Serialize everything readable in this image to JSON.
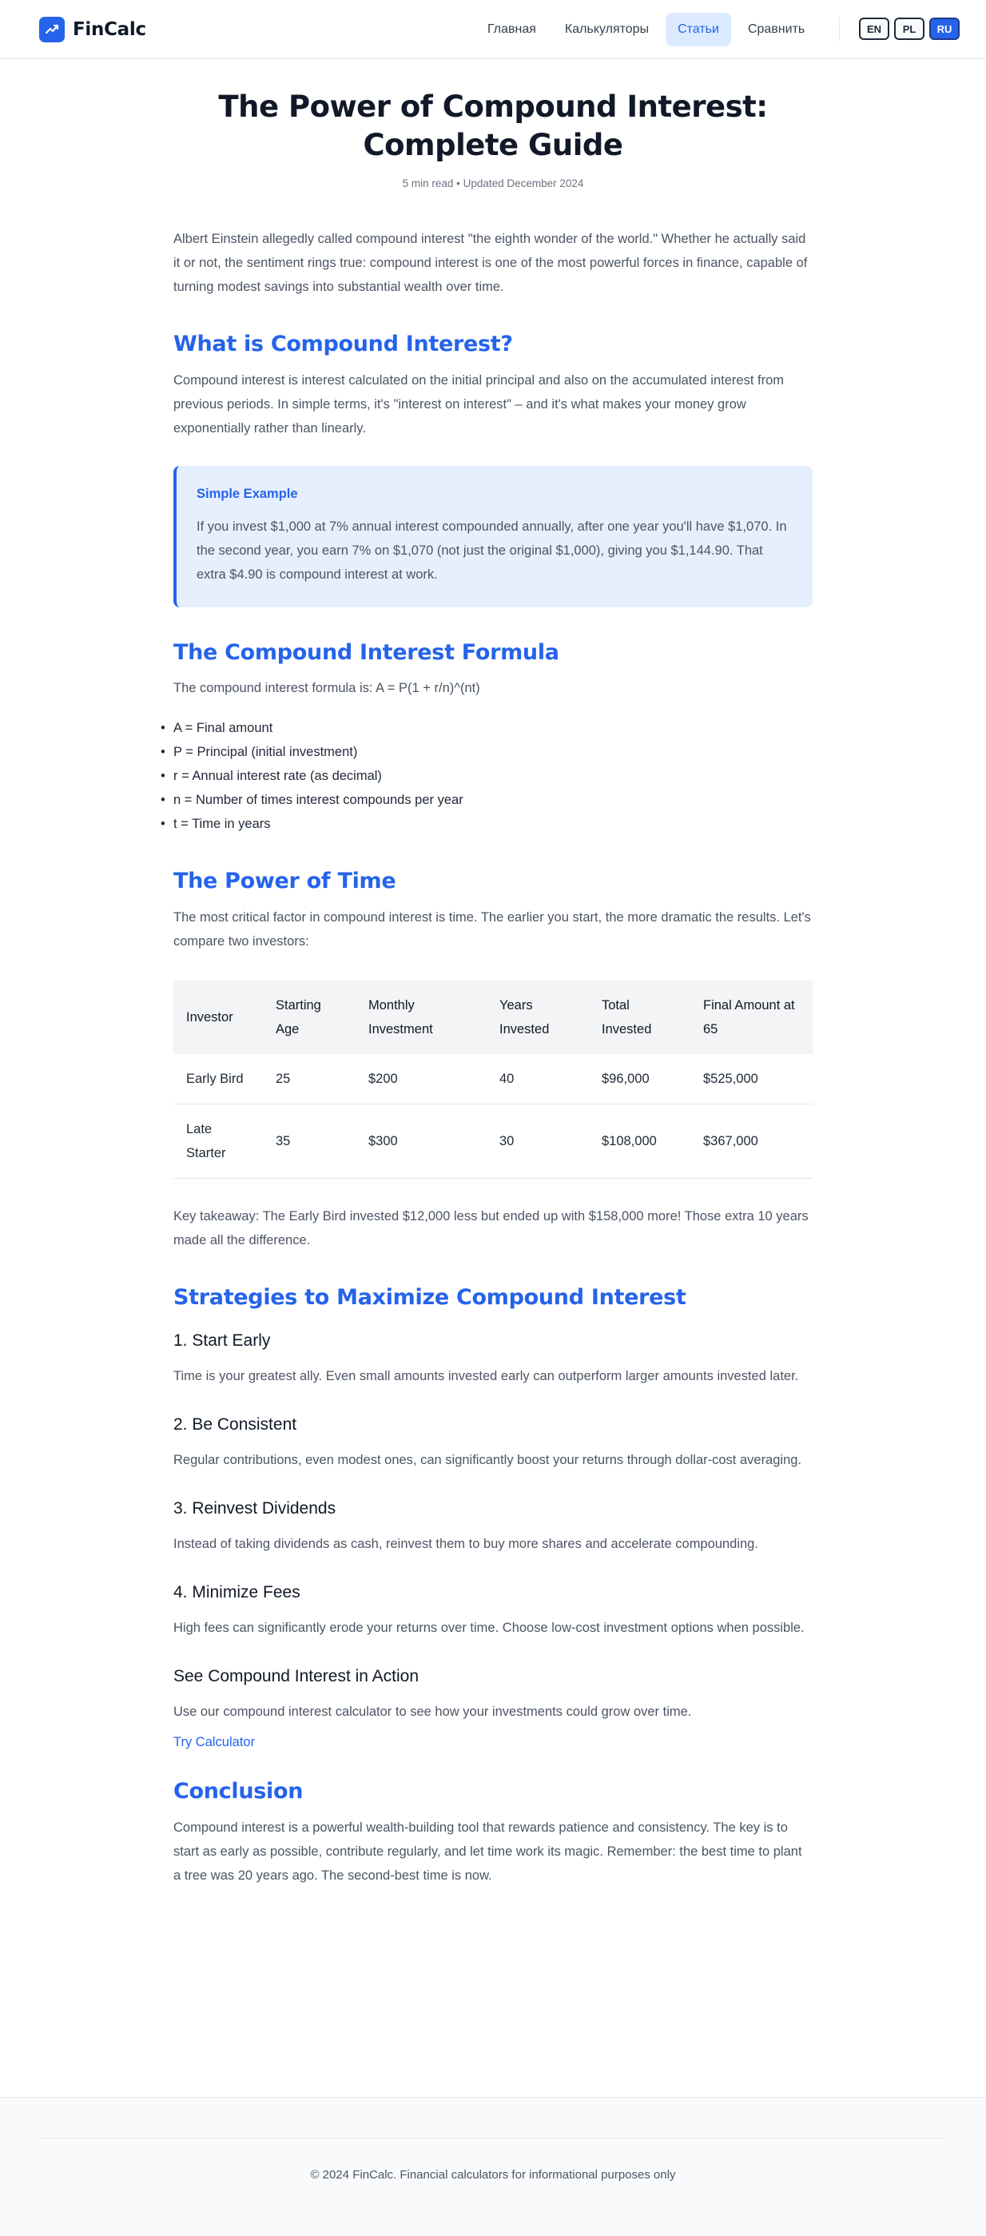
{
  "header": {
    "brand": "FinCalc",
    "nav": [
      "Главная",
      "Калькуляторы",
      "Статьи",
      "Сравнить"
    ],
    "active_nav": "Статьи",
    "languages": [
      "EN",
      "PL",
      "RU"
    ],
    "active_language": "RU"
  },
  "article": {
    "title_line1": "The Power of Compound Interest:",
    "title_line2": "Complete Guide",
    "meta": "5 min read • Updated December 2024",
    "intro": "Albert Einstein allegedly called compound interest \"the eighth wonder of the world.\" Whether he actually said it or not, the sentiment rings true: compound interest is one of the most powerful forces in finance, capable of turning modest savings into substantial wealth over time.",
    "what_heading": "What is Compound Interest?",
    "what_text": "Compound interest is interest calculated on the initial principal and also on the accumulated interest from previous periods. In simple terms, it's \"interest on interest\" – and it's what makes your money grow exponentially rather than linearly.",
    "example_title": "Simple Example",
    "example_text": "If you invest $1,000 at 7% annual interest compounded annually, after one year you'll have $1,070. In the second year, you earn 7% on $1,070 (not just the original $1,000), giving you $1,144.90. That extra $4.90 is compound interest at work.",
    "formula_heading": "The Compound Interest Formula",
    "formula_text": "The compound interest formula is: A = P(1 + r/n)^(nt)",
    "formula_vars": [
      "A = Final amount",
      "P = Principal (initial investment)",
      "r = Annual interest rate (as decimal)",
      "n = Number of times interest compounds per year",
      "t = Time in years"
    ],
    "time_heading": "The Power of Time",
    "time_text": "The most critical factor in compound interest is time. The earlier you start, the more dramatic the results. Let's compare two investors:",
    "table": {
      "headers": [
        "Investor",
        "Starting Age",
        "Monthly Investment",
        "Years Invested",
        "Total Invested",
        "Final Amount at 65"
      ],
      "rows": [
        [
          "Early Bird",
          "25",
          "$200",
          "40",
          "$96,000",
          "$525,000"
        ],
        [
          "Late Starter",
          "35",
          "$300",
          "30",
          "$108,000",
          "$367,000"
        ]
      ]
    },
    "takeaway": "Key takeaway: The Early Bird invested $12,000 less but ended up with $158,000 more! Those extra 10 years made all the difference.",
    "strategies_heading": "Strategies to Maximize Compound Interest",
    "strategies": [
      {
        "title": "1. Start Early",
        "text": "Time is your greatest ally. Even small amounts invested early can outperform larger amounts invested later."
      },
      {
        "title": "2. Be Consistent",
        "text": "Regular contributions, even modest ones, can significantly boost your returns through dollar-cost averaging."
      },
      {
        "title": "3. Reinvest Dividends",
        "text": "Instead of taking dividends as cash, reinvest them to buy more shares and accelerate compounding."
      },
      {
        "title": "4. Minimize Fees",
        "text": "High fees can significantly erode your returns over time. Choose low-cost investment options when possible."
      }
    ],
    "action_heading": "See Compound Interest in Action",
    "action_text": "Use our compound interest calculator to see how your investments could grow over time.",
    "action_link": "Try Calculator",
    "conclusion_heading": "Conclusion",
    "conclusion_text": "Compound interest is a powerful wealth-building tool that rewards patience and consistency. The key is to start as early as possible, contribute regularly, and let time work its magic. Remember: the best time to plant a tree was 20 years ago. The second-best time is now."
  },
  "footer": {
    "text": "© 2024 FinCalc. Financial calculators for informational purposes only"
  }
}
